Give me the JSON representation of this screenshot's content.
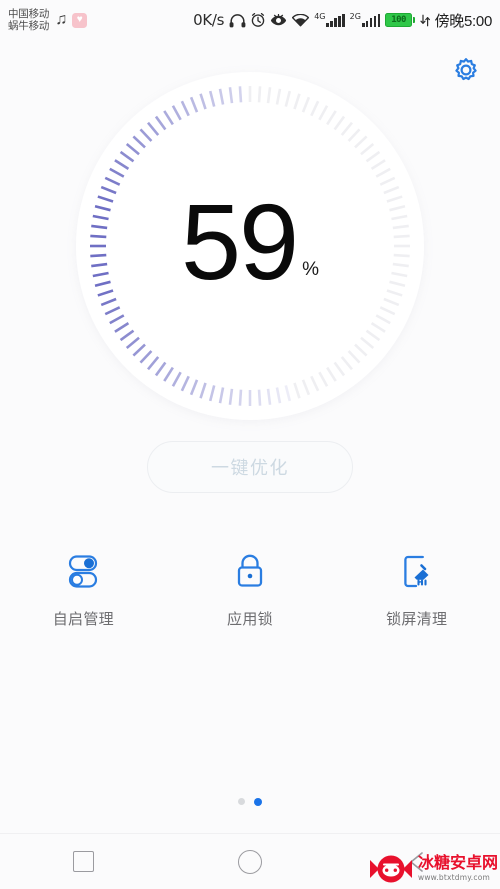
{
  "status_bar": {
    "carrier_primary": "中国移动",
    "carrier_secondary": "蜗牛移动",
    "music_icon": "music-note-icon",
    "heart_icon": "heart-badge-icon",
    "network_speed": "0K/s",
    "headset_icon": "headset-icon",
    "alarm_icon": "alarm-clock-icon",
    "eye_icon": "eye-comfort-icon",
    "wifi_icon": "wifi-icon",
    "sim1_network": "4G",
    "sim2_network": "2G",
    "battery_percent": "100",
    "sync_icon": "data-sync-icon",
    "time": "傍晚5:00"
  },
  "header": {
    "settings_icon": "gear-icon"
  },
  "gauge": {
    "value": "59",
    "unit": "%",
    "active_color": "#6f6fc4",
    "inactive_color": "#efeff2",
    "total_ticks": 100,
    "active_ticks": 59
  },
  "optimize": {
    "label": "一键优化"
  },
  "shortcuts": [
    {
      "label": "自启管理",
      "icon": "toggle-switches-icon"
    },
    {
      "label": "应用锁",
      "icon": "padlock-icon"
    },
    {
      "label": "锁屏清理",
      "icon": "phone-broom-icon"
    }
  ],
  "pagination": {
    "pages": 2,
    "active_index": 1
  },
  "nav_bar": {
    "recents_label": "recents-square-icon",
    "home_label": "home-circle-icon",
    "back_label": "back-chevron-icon"
  },
  "watermark": {
    "title": "冰糖安卓网",
    "url": "www.btxtdmy.com",
    "logo": "candy-gamepad-logo",
    "color": "#e8112d"
  }
}
